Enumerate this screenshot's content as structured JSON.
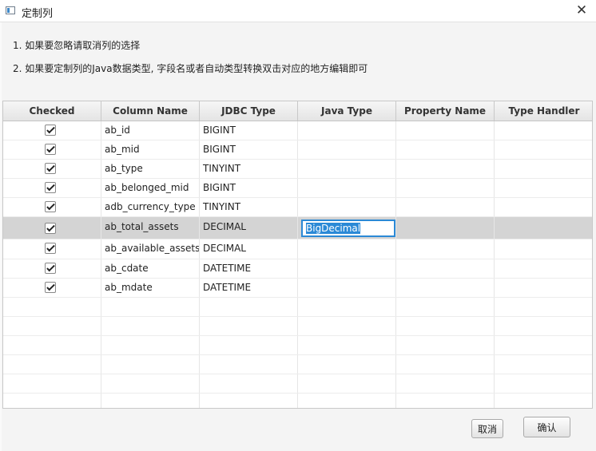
{
  "dialog": {
    "title": "定制列",
    "close_symbol": "✕"
  },
  "instructions": [
    "1. 如果要忽略请取消列的选择",
    "2. 如果要定制列的Java数据类型, 字段名或者自动类型转换双击对应的地方编辑即可"
  ],
  "table": {
    "columns": [
      "Checked",
      "Column Name",
      "JDBC Type",
      "Java Type",
      "Property Name",
      "Type Handler"
    ],
    "rows": [
      {
        "checked": true,
        "column_name": "ab_id",
        "jdbc_type": "BIGINT",
        "java_type": "",
        "property_name": "",
        "type_handler": ""
      },
      {
        "checked": true,
        "column_name": "ab_mid",
        "jdbc_type": "BIGINT",
        "java_type": "",
        "property_name": "",
        "type_handler": ""
      },
      {
        "checked": true,
        "column_name": "ab_type",
        "jdbc_type": "TINYINT",
        "java_type": "",
        "property_name": "",
        "type_handler": ""
      },
      {
        "checked": true,
        "column_name": "ab_belonged_mid",
        "jdbc_type": "BIGINT",
        "java_type": "",
        "property_name": "",
        "type_handler": ""
      },
      {
        "checked": true,
        "column_name": "adb_currency_type",
        "jdbc_type": "TINYINT",
        "java_type": "",
        "property_name": "",
        "type_handler": ""
      },
      {
        "checked": true,
        "column_name": "ab_total_assets",
        "jdbc_type": "DECIMAL",
        "java_type": "BigDecimal",
        "property_name": "",
        "type_handler": ""
      },
      {
        "checked": true,
        "column_name": "ab_available_assets",
        "jdbc_type": "DECIMAL",
        "java_type": "",
        "property_name": "",
        "type_handler": ""
      },
      {
        "checked": true,
        "column_name": "ab_cdate",
        "jdbc_type": "DATETIME",
        "java_type": "",
        "property_name": "",
        "type_handler": ""
      },
      {
        "checked": true,
        "column_name": "ab_mdate",
        "jdbc_type": "DATETIME",
        "java_type": "",
        "property_name": "",
        "type_handler": ""
      }
    ],
    "editing_value": "BigDecimal"
  },
  "buttons": {
    "cancel": "取消",
    "confirm": "确认"
  }
}
